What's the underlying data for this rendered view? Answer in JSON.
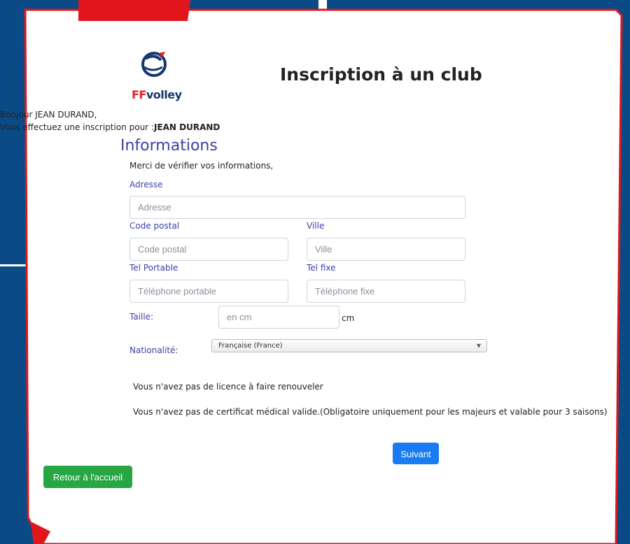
{
  "brand": {
    "logo_text_ff": "FF",
    "logo_text_volley": "volley",
    "accent_red": "#e32226",
    "brand_blue": "#15386f",
    "background_blue": "#0a4b87"
  },
  "header": {
    "title": "Inscription à un club"
  },
  "greeting": {
    "line1": "Bonjour JEAN DURAND,",
    "line2_prefix": "Vous effectuez une inscription pour :",
    "line2_name": "JEAN DURAND"
  },
  "section": {
    "title": "Informations",
    "intro": "Merci de vérifier vos informations,"
  },
  "form": {
    "adresse": {
      "label": "Adresse",
      "placeholder": "Adresse",
      "value": ""
    },
    "code_postal": {
      "label": "Code postal",
      "placeholder": "Code postal",
      "value": ""
    },
    "ville": {
      "label": "Ville",
      "placeholder": "Ville",
      "value": ""
    },
    "tel_portable": {
      "label": "Tel Portable",
      "placeholder": "Téléphone portable",
      "value": ""
    },
    "tel_fixe": {
      "label": "Tel fixe",
      "placeholder": "Téléphone fixe",
      "value": ""
    },
    "taille": {
      "label": "Taille:",
      "placeholder": "en cm",
      "unit": "cm",
      "value": ""
    },
    "nationalite": {
      "label": "Nationalité:",
      "selected": "Française (France)"
    }
  },
  "notices": {
    "licence": "Vous n'avez pas de licence à faire renouveler",
    "certificat": "Vous n'avez pas de certificat médical valide.(Obligatoire uniquement pour les majeurs et valable pour 3 saisons)"
  },
  "buttons": {
    "next": "Suivant",
    "home": "Retour à l'accueil",
    "next_color": "#1a7cf2",
    "home_color": "#27a643"
  },
  "icons": {
    "select_arrow": "chevron-down-icon",
    "logo": "ffvolley-logo-icon"
  }
}
